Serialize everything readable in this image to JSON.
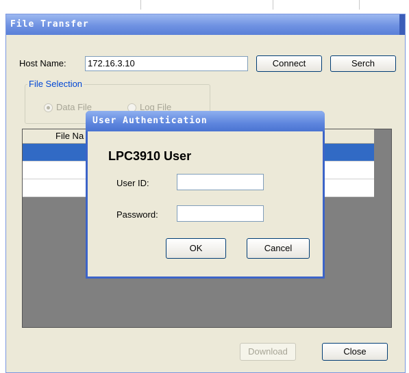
{
  "main_window": {
    "title": "File Transfer",
    "host_label": "Host Name:",
    "host_value": "172.16.3.10",
    "connect_label": "Connect",
    "search_label": "Serch",
    "file_selection": {
      "title": "File Selection",
      "options": [
        {
          "label": "Data File",
          "checked": true,
          "enabled": false
        },
        {
          "label": "Log File",
          "checked": false,
          "enabled": false
        }
      ]
    },
    "table": {
      "columns": [
        "File Na"
      ],
      "rows": [
        {
          "selected": true
        },
        {
          "selected": false
        },
        {
          "selected": false
        }
      ]
    },
    "download_label": "Download",
    "close_label": "Close"
  },
  "auth_dialog": {
    "title": "User Authentication",
    "heading": "LPC3910 User",
    "user_id_label": "User ID:",
    "user_id_value": "",
    "password_label": "Password:",
    "password_value": "",
    "ok_label": "OK",
    "cancel_label": "Cancel"
  },
  "colors": {
    "titlebar": "#6f92e2",
    "selection": "#316ac5",
    "groupbox_title": "#0046d5",
    "window_bg": "#ece9d8",
    "grid_bg": "#808080"
  }
}
